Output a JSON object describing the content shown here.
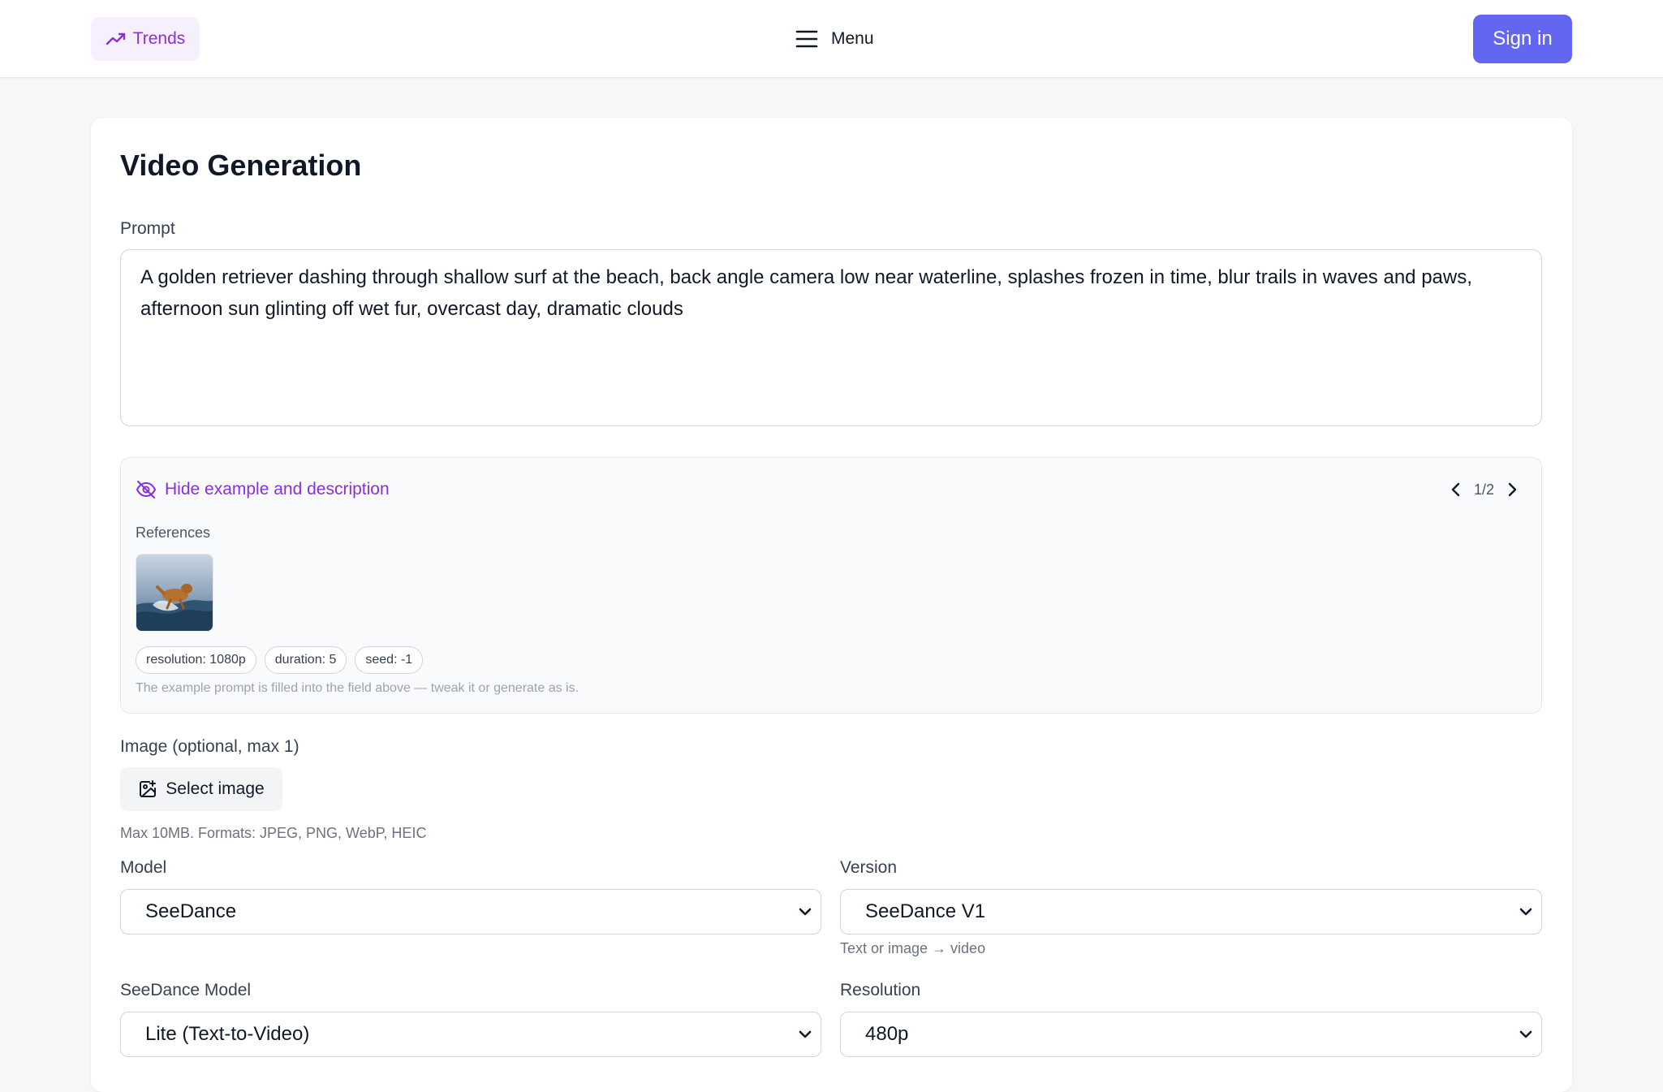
{
  "nav": {
    "trends_label": "Trends",
    "menu_label": "Menu",
    "signin_label": "Sign in"
  },
  "page": {
    "title": "Video Generation"
  },
  "prompt": {
    "label": "Prompt",
    "value": "A golden retriever dashing through shallow surf at the beach, back angle camera low near waterline, splashes frozen in time, blur trails in waves and paws, afternoon sun glinting off wet fur, overcast day, dramatic clouds"
  },
  "example": {
    "toggle_label": "Hide example and description",
    "pager": "1/2",
    "references_label": "References",
    "chips": [
      "resolution: 1080p",
      "duration: 5",
      "seed: -1"
    ],
    "note": "The example prompt is filled into the field above — tweak it or generate as is."
  },
  "image_upload": {
    "label": "Image (optional, max 1)",
    "button_label": "Select image",
    "hint": "Max 10MB. Formats: JPEG, PNG, WebP, HEIC"
  },
  "model": {
    "label": "Model",
    "value": "SeeDance"
  },
  "version": {
    "label": "Version",
    "value": "SeeDance V1",
    "hint": "Text or image → video"
  },
  "seedance_model": {
    "label": "SeeDance Model",
    "value": "Lite (Text-to-Video)"
  },
  "resolution": {
    "label": "Resolution",
    "value": "480p"
  },
  "colors": {
    "accent": "#6366f1",
    "purple_text": "#8b2fd8",
    "trends_bg": "#f6effd"
  }
}
